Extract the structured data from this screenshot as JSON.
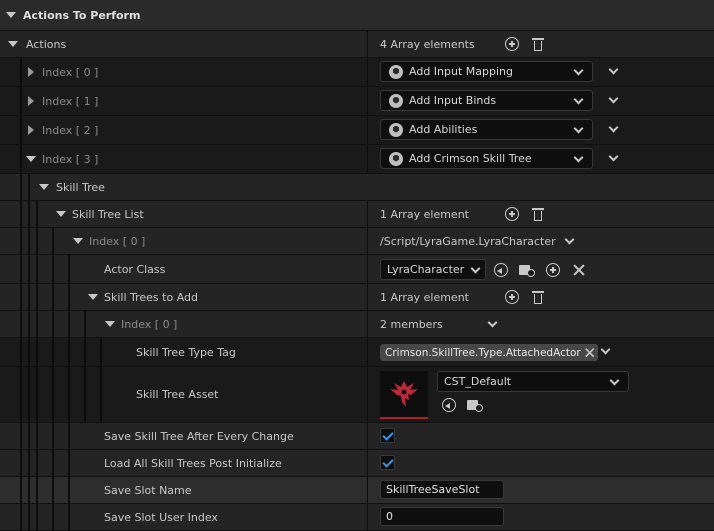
{
  "section": {
    "title": "Actions To Perform"
  },
  "actions": {
    "label": "Actions",
    "count": "4 Array elements",
    "items": [
      {
        "index": "Index [ 0 ]",
        "value": "Add Input Mapping"
      },
      {
        "index": "Index [ 1 ]",
        "value": "Add Input Binds"
      },
      {
        "index": "Index [ 2 ]",
        "value": "Add Abilities"
      },
      {
        "index": "Index [ 3 ]",
        "value": "Add Crimson Skill Tree"
      }
    ]
  },
  "skill_tree": {
    "label": "Skill Tree",
    "list_label": "Skill Tree List",
    "list_count": "1 Array element",
    "index0": "Index [ 0 ]",
    "index0_class": "/Script/LyraGame.LyraCharacter",
    "actor_class_label": "Actor Class",
    "actor_class_value": "LyraCharacter",
    "trees_to_add_label": "Skill Trees to Add",
    "trees_to_add_count": "1 Array element",
    "tree_index": "Index [ 0 ]",
    "tree_members": "2 members",
    "type_tag_label": "Skill Tree Type Tag",
    "type_tag_value": "Crimson.SkillTree.Type.AttachedActor",
    "asset_label": "Skill Tree Asset",
    "asset_value": "CST_Default"
  },
  "settings": {
    "save_after_change_label": "Save Skill Tree After Every Change",
    "load_all_label": "Load All Skill Trees Post Initialize",
    "slot_name_label": "Save Slot Name",
    "slot_name_value": "SkillTreeSaveSlot",
    "slot_index_label": "Save Slot User Index",
    "slot_index_value": "0"
  },
  "colors": {
    "accent": "#2c9bf0",
    "thumb_underline": "#b0202a",
    "icon_red": "#c0283a"
  }
}
